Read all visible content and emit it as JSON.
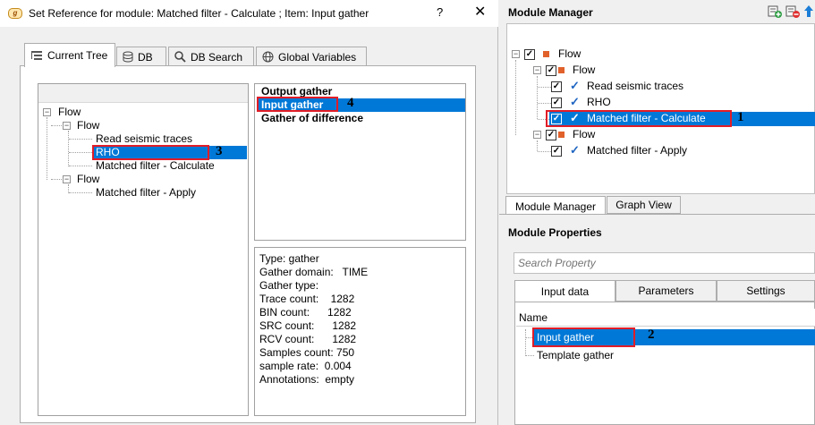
{
  "dialog": {
    "title": "Set Reference for module: Matched filter - Calculate ; Item: Input gather",
    "help_glyph": "?",
    "close_glyph": "✕",
    "app_icon_text": "g",
    "tabs": [
      {
        "label": "Current Tree",
        "icon": "tree-icon"
      },
      {
        "label": "DB",
        "icon": "database-icon"
      },
      {
        "label": "DB Search",
        "icon": "search-icon"
      },
      {
        "label": "Global Variables",
        "icon": "globe-icon"
      }
    ],
    "tree": {
      "root": "Flow",
      "flow1": "Flow",
      "flow1_items": [
        "Read seismic traces",
        "RHO",
        "Matched filter - Calculate"
      ],
      "flow2": "Flow",
      "flow2_items": [
        "Matched filter - Apply"
      ]
    },
    "gathers": [
      "Output gather",
      "Input gather",
      "Gather of difference"
    ],
    "info": [
      "Type: gather",
      "Gather domain:   TIME",
      "Gather type:",
      "Trace count:    1282",
      "BIN count:      1282",
      "SRC count:      1282",
      "RCV count:      1282",
      "Samples count: 750",
      "sample rate:  0.004",
      "Annotations:  empty"
    ],
    "callouts": {
      "rho": "3",
      "input_gather": "4"
    }
  },
  "module_manager": {
    "title": "Module Manager",
    "tree": {
      "root": "Flow",
      "flow1": "Flow",
      "flow1_items": [
        "Read seismic traces",
        "RHO",
        "Matched filter - Calculate"
      ],
      "flow2": "Flow",
      "flow2_items": [
        "Matched filter - Apply"
      ]
    },
    "tabs": [
      "Module Manager",
      "Graph View"
    ],
    "callout": "1"
  },
  "module_properties": {
    "title": "Module Properties",
    "search_placeholder": "Search Property",
    "tabs": [
      "Input data",
      "Parameters",
      "Settings"
    ],
    "column": "Name",
    "items": [
      "Input gather",
      "Template gather"
    ],
    "callout": "2"
  },
  "colors": {
    "selection": "#0078d7",
    "highlight_box": "#e11d27",
    "flow_square": "#e1612b",
    "check": "#1f65c1"
  }
}
